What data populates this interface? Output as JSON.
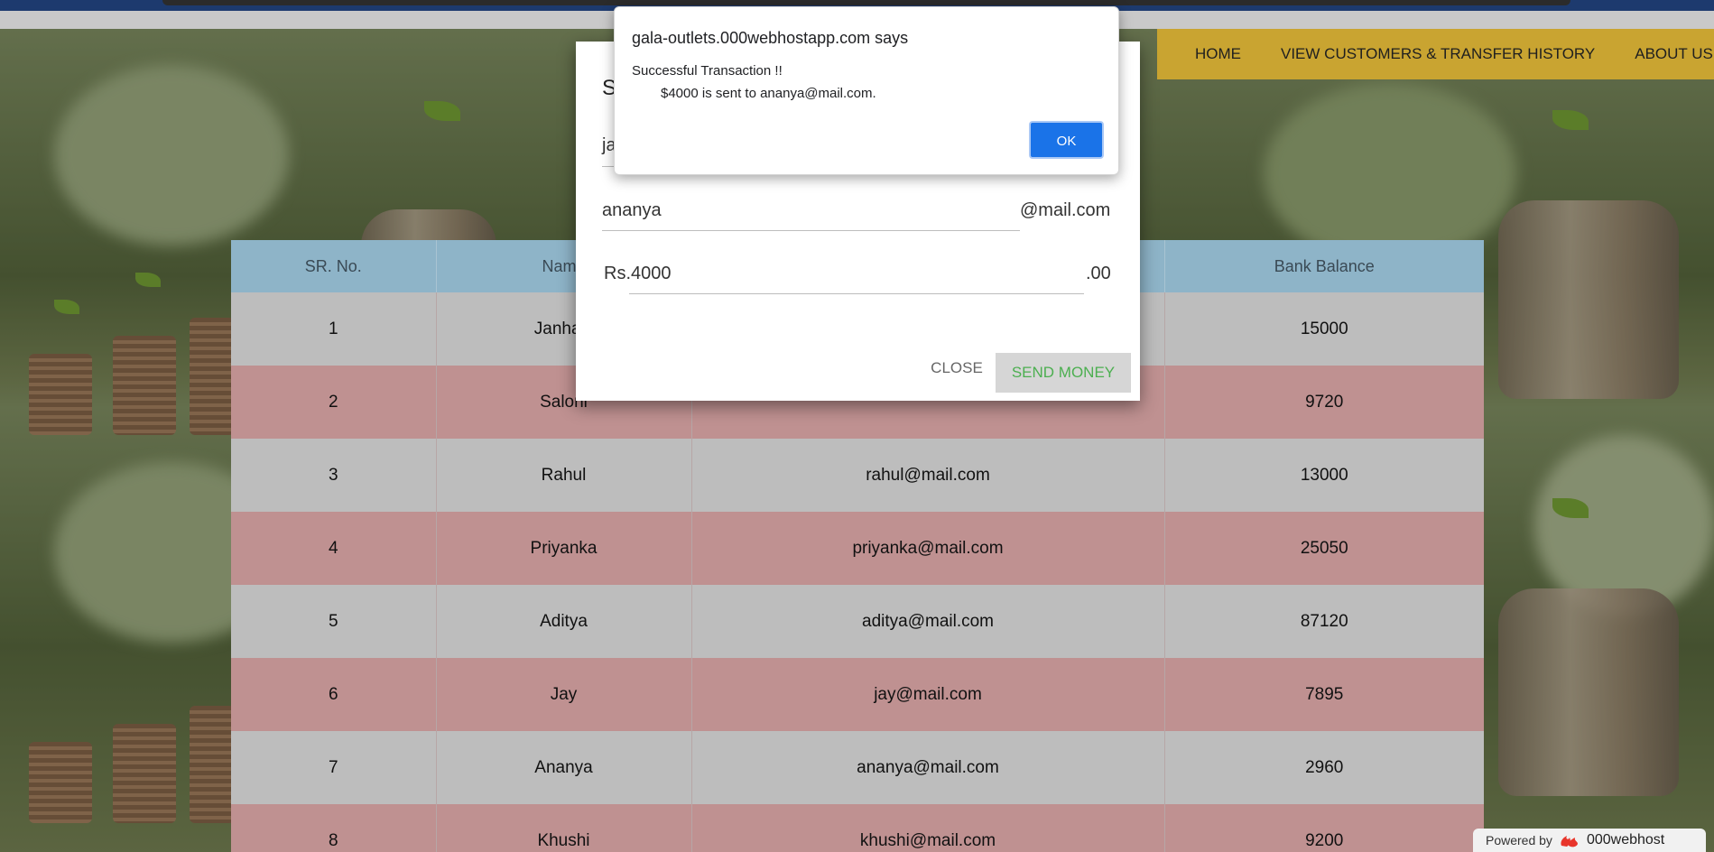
{
  "nav": {
    "items": [
      "HOME",
      "VIEW CUSTOMERS & TRANSFER HISTORY",
      "ABOUT US"
    ]
  },
  "table": {
    "headers": [
      "SR. No.",
      "Name",
      "",
      "Bank Balance"
    ],
    "rows": [
      {
        "sr": "1",
        "name": "Janhavi",
        "email": "",
        "balance": "15000"
      },
      {
        "sr": "2",
        "name": "Saloni",
        "email": "",
        "balance": "9720"
      },
      {
        "sr": "3",
        "name": "Rahul",
        "email": "rahul@mail.com",
        "balance": "13000"
      },
      {
        "sr": "4",
        "name": "Priyanka",
        "email": "priyanka@mail.com",
        "balance": "25050"
      },
      {
        "sr": "5",
        "name": "Aditya",
        "email": "aditya@mail.com",
        "balance": "87120"
      },
      {
        "sr": "6",
        "name": "Jay",
        "email": "jay@mail.com",
        "balance": "7895"
      },
      {
        "sr": "7",
        "name": "Ananya",
        "email": "ananya@mail.com",
        "balance": "2960"
      },
      {
        "sr": "8",
        "name": "Khushi",
        "email": "khushi@mail.com",
        "balance": "9200"
      }
    ]
  },
  "modal": {
    "title": "S",
    "from_value": "ja",
    "to_value": "ananya",
    "to_suffix": "@mail.com",
    "amount_value": "Rs.4000",
    "amount_suffix": ".00",
    "close_label": "CLOSE",
    "send_label": "SEND MONEY"
  },
  "alert": {
    "title": "gala-outlets.000webhostapp.com says",
    "line1": "Successful Transaction !!",
    "line2": "$4000 is sent to ananya@mail.com.",
    "ok_label": "OK"
  },
  "badge": {
    "prefix": "Powered by",
    "brand": "000webhost"
  }
}
